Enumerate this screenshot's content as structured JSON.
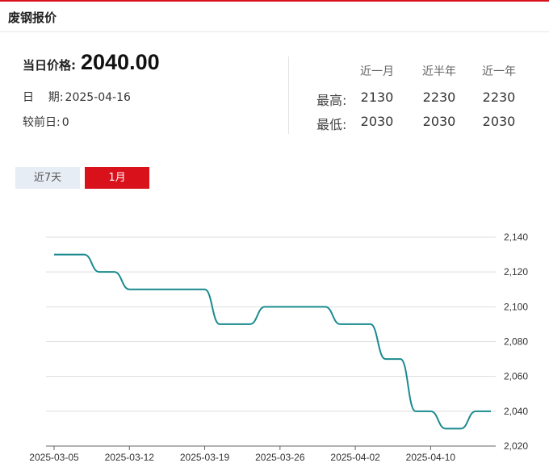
{
  "header": {
    "title": "废钢报价"
  },
  "price": {
    "label": "当日价格:",
    "value": "2040.00"
  },
  "date": {
    "label": "日    期:",
    "value": "2025-04-16"
  },
  "change": {
    "label": "较前日:",
    "value": "0"
  },
  "stats": {
    "columns": [
      "近一月",
      "近半年",
      "近一年"
    ],
    "rows": [
      {
        "label": "最高:",
        "values": [
          "2130",
          "2230",
          "2230"
        ]
      },
      {
        "label": "最低:",
        "values": [
          "2030",
          "2030",
          "2030"
        ]
      }
    ]
  },
  "tabs": [
    {
      "label": "近7天",
      "active": false
    },
    {
      "label": "1月",
      "active": true
    }
  ],
  "colors": {
    "accent": "#d9111b",
    "line": "#1a8a8f",
    "grid": "#dddddd"
  },
  "chart_data": {
    "type": "line",
    "x": [
      "2025-03-05",
      "2025-03-06",
      "2025-03-07",
      "2025-03-10",
      "2025-03-11",
      "2025-03-12",
      "2025-03-13",
      "2025-03-14",
      "2025-03-17",
      "2025-03-18",
      "2025-03-19",
      "2025-03-20",
      "2025-03-21",
      "2025-03-24",
      "2025-03-25",
      "2025-03-26",
      "2025-03-27",
      "2025-03-28",
      "2025-03-31",
      "2025-04-01",
      "2025-04-02",
      "2025-04-03",
      "2025-04-07",
      "2025-04-08",
      "2025-04-09",
      "2025-04-10",
      "2025-04-11",
      "2025-04-14",
      "2025-04-15",
      "2025-04-16"
    ],
    "values": [
      2130,
      2130,
      2130,
      2120,
      2120,
      2110,
      2110,
      2110,
      2110,
      2110,
      2110,
      2090,
      2090,
      2090,
      2100,
      2100,
      2100,
      2100,
      2100,
      2090,
      2090,
      2090,
      2070,
      2070,
      2040,
      2040,
      2030,
      2030,
      2040,
      2040
    ],
    "xticks": [
      "2025-03-05",
      "2025-03-12",
      "2025-03-19",
      "2025-03-26",
      "2025-04-02",
      "2025-04-10"
    ],
    "yticks": [
      "2,140",
      "2,120",
      "2,100",
      "2,080",
      "2,060",
      "2,040",
      "2,020"
    ],
    "ylim": [
      2020,
      2140
    ],
    "title": "",
    "xlabel": "",
    "ylabel": "",
    "grid": true,
    "legend": "none"
  }
}
